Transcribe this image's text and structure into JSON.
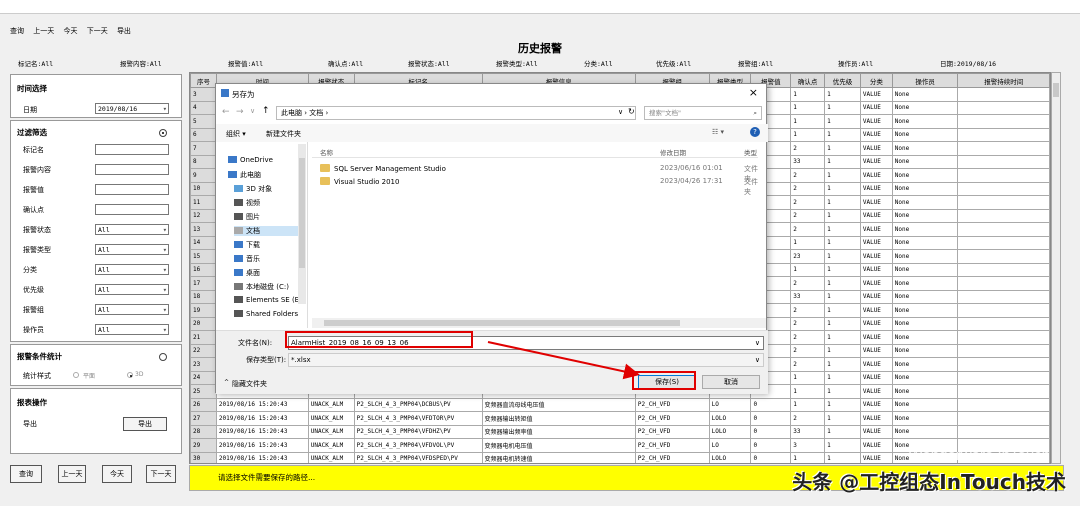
{
  "menu": [
    "查询",
    "上一天",
    "今天",
    "下一天",
    "导出"
  ],
  "title": "历史报警",
  "filters": [
    {
      "text": "标记名:All"
    },
    {
      "text": "报警内容:All"
    },
    {
      "text": "报警值:All"
    },
    {
      "text": "确认点:All"
    },
    {
      "text": "报警状态:All"
    },
    {
      "text": "报警类型:All"
    },
    {
      "text": "分类:All"
    },
    {
      "text": "优先级:All"
    },
    {
      "text": "报警组:All"
    },
    {
      "text": "操作员:All"
    },
    {
      "text": "日期:2019/08/16"
    }
  ],
  "left": {
    "time_section": "时间选择",
    "date_label": "日期",
    "date_value": "2019/08/16",
    "filter_section": "过滤筛选",
    "fields": [
      {
        "label": "标记名",
        "value": ""
      },
      {
        "label": "报警内容",
        "value": ""
      },
      {
        "label": "报警值",
        "value": ""
      },
      {
        "label": "确认点",
        "value": ""
      },
      {
        "label": "报警状态",
        "value": "All"
      },
      {
        "label": "报警类型",
        "value": "All"
      },
      {
        "label": "分类",
        "value": "All"
      },
      {
        "label": "优先级",
        "value": "All"
      },
      {
        "label": "报警组",
        "value": "All"
      },
      {
        "label": "操作员",
        "value": "All"
      }
    ],
    "stats_section": "报警条件统计",
    "stats_style_label": "统计样式",
    "stats_opt1": "平面",
    "stats_opt2": "3D",
    "report_section": "报表操作",
    "export_label": "导出",
    "export_button": "导出",
    "bottom_buttons": [
      "查询",
      "上一天",
      "今天",
      "下一天"
    ]
  },
  "table": {
    "headers": [
      "序号",
      "时间",
      "报警状态",
      "标记名",
      "报警信息",
      "报警组",
      "报警类型",
      "报警值",
      "确认点",
      "优先级",
      "分类",
      "操作员",
      "报警持续时间"
    ],
    "rows": [
      [
        "3",
        "",
        "",
        "",
        "",
        "",
        "",
        "",
        "1",
        "1",
        "VALUE",
        "None",
        ""
      ],
      [
        "4",
        "",
        "",
        "",
        "",
        "",
        "",
        "",
        "1",
        "1",
        "VALUE",
        "None",
        ""
      ],
      [
        "5",
        "",
        "",
        "",
        "",
        "",
        "",
        "",
        "1",
        "1",
        "VALUE",
        "None",
        ""
      ],
      [
        "6",
        "",
        "",
        "",
        "",
        "",
        "",
        "",
        "1",
        "1",
        "VALUE",
        "None",
        ""
      ],
      [
        "7",
        "",
        "",
        "",
        "",
        "",
        "",
        "",
        "2",
        "1",
        "VALUE",
        "None",
        ""
      ],
      [
        "8",
        "",
        "",
        "",
        "",
        "",
        "",
        "",
        "33",
        "1",
        "VALUE",
        "None",
        ""
      ],
      [
        "9",
        "",
        "",
        "",
        "",
        "",
        "",
        "",
        "2",
        "1",
        "VALUE",
        "None",
        ""
      ],
      [
        "10",
        "",
        "",
        "",
        "",
        "",
        "",
        "",
        "2",
        "1",
        "VALUE",
        "None",
        ""
      ],
      [
        "11",
        "",
        "",
        "",
        "",
        "",
        "",
        "",
        "2",
        "1",
        "VALUE",
        "None",
        ""
      ],
      [
        "12",
        "",
        "",
        "",
        "",
        "",
        "",
        "",
        "2",
        "1",
        "VALUE",
        "None",
        ""
      ],
      [
        "13",
        "",
        "",
        "",
        "",
        "",
        "",
        "",
        "2",
        "1",
        "VALUE",
        "None",
        ""
      ],
      [
        "14",
        "",
        "",
        "",
        "",
        "",
        "",
        "",
        "1",
        "1",
        "VALUE",
        "None",
        ""
      ],
      [
        "15",
        "",
        "",
        "",
        "",
        "",
        "",
        "",
        "23",
        "1",
        "VALUE",
        "None",
        ""
      ],
      [
        "16",
        "",
        "",
        "",
        "",
        "",
        "",
        "",
        "1",
        "1",
        "VALUE",
        "None",
        ""
      ],
      [
        "17",
        "",
        "",
        "",
        "",
        "",
        "",
        "",
        "2",
        "1",
        "VALUE",
        "None",
        ""
      ],
      [
        "18",
        "",
        "",
        "",
        "",
        "",
        "",
        "",
        "33",
        "1",
        "VALUE",
        "None",
        ""
      ],
      [
        "19",
        "",
        "",
        "",
        "",
        "",
        "",
        "",
        "2",
        "1",
        "VALUE",
        "None",
        ""
      ],
      [
        "20",
        "",
        "",
        "",
        "",
        "",
        "",
        "",
        "2",
        "1",
        "VALUE",
        "None",
        ""
      ],
      [
        "21",
        "",
        "",
        "",
        "",
        "",
        "",
        "",
        "2",
        "1",
        "VALUE",
        "None",
        ""
      ],
      [
        "22",
        "",
        "",
        "",
        "",
        "",
        "",
        "",
        "2",
        "1",
        "VALUE",
        "None",
        ""
      ],
      [
        "23",
        "",
        "",
        "",
        "",
        "",
        "",
        "",
        "2",
        "1",
        "VALUE",
        "None",
        ""
      ],
      [
        "24",
        "",
        "",
        "",
        "",
        "",
        "",
        "",
        "1",
        "1",
        "VALUE",
        "None",
        ""
      ],
      [
        "25",
        "",
        "",
        "",
        "",
        "",
        "",
        "",
        "1",
        "1",
        "VALUE",
        "None",
        ""
      ],
      [
        "26",
        "2019/08/16 15:20:43",
        "UNACK_ALM",
        "P2_SLCH_4_3_PMP04\\DCBUS\\PV",
        "变频器直流母线电压值",
        "P2_CH_VFD",
        "LO",
        "0",
        "1",
        "1",
        "VALUE",
        "None",
        ""
      ],
      [
        "27",
        "2019/08/16 15:20:43",
        "UNACK_ALM",
        "P2_SLCH_4_3_PMP04\\VFDTOR\\PV",
        "变频器输出转矩值",
        "P2_CH_VFD",
        "LOLO",
        "0",
        "2",
        "1",
        "VALUE",
        "None",
        ""
      ],
      [
        "28",
        "2019/08/16 15:20:43",
        "UNACK_ALM",
        "P2_SLCH_4_3_PMP04\\VFDHZ\\PV",
        "变频器输出频率值",
        "P2_CH_VFD",
        "LOLO",
        "0",
        "33",
        "1",
        "VALUE",
        "None",
        ""
      ],
      [
        "29",
        "2019/08/16 15:20:43",
        "UNACK_ALM",
        "P2_SLCH_4_3_PMP04\\VFDVOL\\PV",
        "变频器电机电压值",
        "P2_CH_VFD",
        "LO",
        "0",
        "3",
        "1",
        "VALUE",
        "None",
        ""
      ],
      [
        "30",
        "2019/08/16 15:20:43",
        "UNACK_ALM",
        "P2_SLCH_4_3_PMP04\\VFDSPED\\PV",
        "变频器电机转速值",
        "P2_CH_VFD",
        "LOLO",
        "0",
        "1",
        "1",
        "VALUE",
        "None",
        ""
      ]
    ]
  },
  "status": "请选择文件需要保存的路径...",
  "dialog": {
    "title": "另存为",
    "breadcrumb": "此电脑 › 文档 ›",
    "search_placeholder": "搜索\"文档\"",
    "organize": "组织 ▾",
    "new_folder": "新建文件夹",
    "nav": [
      "OneDrive",
      "此电脑",
      "3D 对象",
      "视频",
      "图片",
      "文档",
      "下载",
      "音乐",
      "桌面",
      "本地磁盘 (C:)",
      "Elements SE (E",
      "Shared Folders"
    ],
    "col_name": "名称",
    "col_date": "修改日期",
    "col_type": "类型",
    "files": [
      {
        "name": "SQL Server Management Studio",
        "date": "2023/06/16 01:01",
        "type": "文件夹"
      },
      {
        "name": "Visual Studio 2010",
        "date": "2023/04/26 17:31",
        "type": "文件夹"
      }
    ],
    "filename_label": "文件名(N):",
    "filename_value": "AlarmHist_2019_08_16_09_13_06",
    "filetype_label": "保存类型(T):",
    "filetype_value": "*.xlsx",
    "hide_folders": "隐藏文件夹",
    "save_button": "保存(S)",
    "cancel_button": "取消"
  },
  "watermark": "头条 @工控组态InTouch技术",
  "watermark2": "Wonderware InTouch"
}
